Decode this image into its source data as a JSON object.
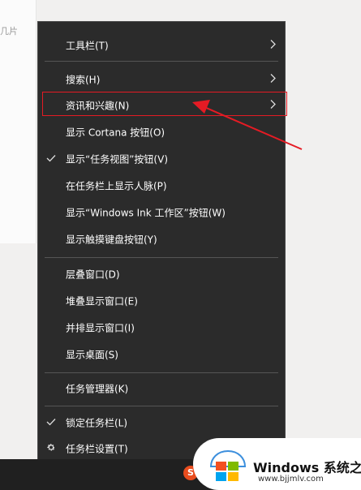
{
  "background": {
    "partial_text": "几片"
  },
  "menu": {
    "items": [
      {
        "label": "工具栏(T)",
        "submenu": true
      },
      {
        "label": "搜索(H)",
        "submenu": true
      },
      {
        "label": "资讯和兴趣(N)",
        "submenu": true,
        "highlighted": true
      },
      {
        "label": "显示 Cortana 按钮(O)"
      },
      {
        "label": "显示“任务视图”按钮(V)",
        "checked": true
      },
      {
        "label": "在任务栏上显示人脉(P)"
      },
      {
        "label": "显示“Windows Ink 工作区”按钮(W)"
      },
      {
        "label": "显示触摸键盘按钮(Y)"
      },
      {
        "label": "层叠窗口(D)"
      },
      {
        "label": "堆叠显示窗口(E)"
      },
      {
        "label": "并排显示窗口(I)"
      },
      {
        "label": "显示桌面(S)"
      },
      {
        "label": "任务管理器(K)"
      },
      {
        "label": "锁定任务栏(L)",
        "checked": true
      },
      {
        "label": "任务栏设置(T)",
        "icon": "gear-icon"
      }
    ],
    "glyphs": {
      "chevron": "›",
      "check": "✓",
      "gear": "⚙"
    }
  },
  "taskbar": {
    "sogou_label": "S"
  },
  "watermark": {
    "title": "Windows 系统之家",
    "url": "www.bjjmlv.com"
  },
  "colors": {
    "menu_bg": "#2b2b2b",
    "annotation": "#e51b24",
    "taskbar": "#202020"
  }
}
